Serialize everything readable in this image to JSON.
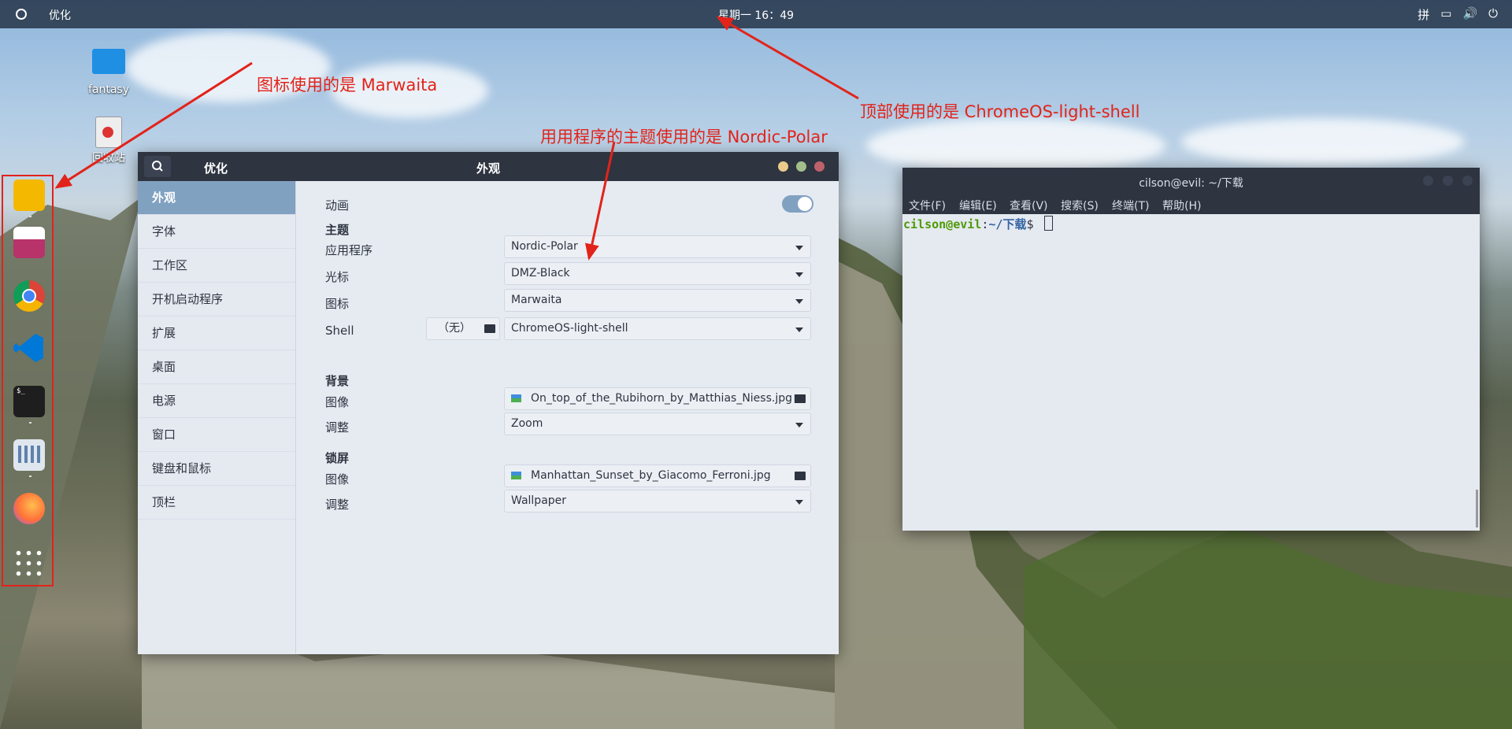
{
  "topbar": {
    "app_name": "优化",
    "clock": "星期一 16：49",
    "tray": {
      "keyboard": "拼",
      "window": "▭",
      "volume": "🔊",
      "power": "⏻"
    }
  },
  "desktop_icons": [
    {
      "label": "fantasy",
      "icon": "folder-icon"
    },
    {
      "label": "回收站",
      "icon": "trash-icon"
    }
  ],
  "dock": {
    "items": [
      {
        "name": "files",
        "icon": "folder-icon",
        "color": "#f5b800"
      },
      {
        "name": "software",
        "icon": "shopping-bag-icon",
        "color": "#e04a7a"
      },
      {
        "name": "chrome",
        "icon": "chrome-icon",
        "color": "#db4437"
      },
      {
        "name": "vscode",
        "icon": "vscode-icon",
        "color": "#0078d7"
      },
      {
        "name": "terminal",
        "icon": "terminal-icon",
        "color": "#1e1e1e"
      },
      {
        "name": "tweaks",
        "icon": "tweaks-icon",
        "color": "#5e81ac"
      },
      {
        "name": "firefox",
        "icon": "firefox-icon",
        "color": "#ff7139"
      },
      {
        "name": "app-grid",
        "icon": "grid-icon",
        "color": "#ffffff"
      }
    ]
  },
  "annotations": {
    "icons": "图标使用的是 Marwaita",
    "shell": "顶部使用的是 ChromeOS-light-shell",
    "theme": "用用程序的主题使用的是 Nordic-Polar"
  },
  "tweaks": {
    "header_left": "优化",
    "title": "外观",
    "sidebar": [
      "外观",
      "字体",
      "工作区",
      "开机启动程序",
      "扩展",
      "桌面",
      "电源",
      "窗口",
      "键盘和鼠标",
      "顶栏"
    ],
    "animation_label": "动画",
    "animation_on": true,
    "themes_section": "主题",
    "app_label": "应用程序",
    "app_value": "Nordic-Polar",
    "cursor_label": "光标",
    "cursor_value": "DMZ-Black",
    "icons_label": "图标",
    "icons_value": "Marwaita",
    "shell_label": "Shell",
    "shell_none": "（无）",
    "shell_value": "ChromeOS-light-shell",
    "background_section": "背景",
    "bg_image_label": "图像",
    "bg_image_value": "On_top_of_the_Rubihorn_by_Matthias_Niess.jpg",
    "bg_adjust_label": "调整",
    "bg_adjust_value": "Zoom",
    "lock_section": "锁屏",
    "lock_image_label": "图像",
    "lock_image_value": "Manhattan_Sunset_by_Giacomo_Ferroni.jpg",
    "lock_adjust_label": "调整",
    "lock_adjust_value": "Wallpaper"
  },
  "terminal": {
    "title": "cilson@evil: ~/下载",
    "menu": [
      "文件(F)",
      "编辑(E)",
      "查看(V)",
      "搜索(S)",
      "终端(T)",
      "帮助(H)"
    ],
    "prompt_user": "cilson@evil",
    "prompt_sep": ":",
    "prompt_path": "~/下载",
    "prompt_symbol": "$"
  },
  "colors": {
    "nord_dark": "#2e3440",
    "nord_accent": "#81a1c1",
    "annotation_red": "#e2231a",
    "prompt_green": "#4e9a06",
    "prompt_blue": "#3465a4"
  }
}
